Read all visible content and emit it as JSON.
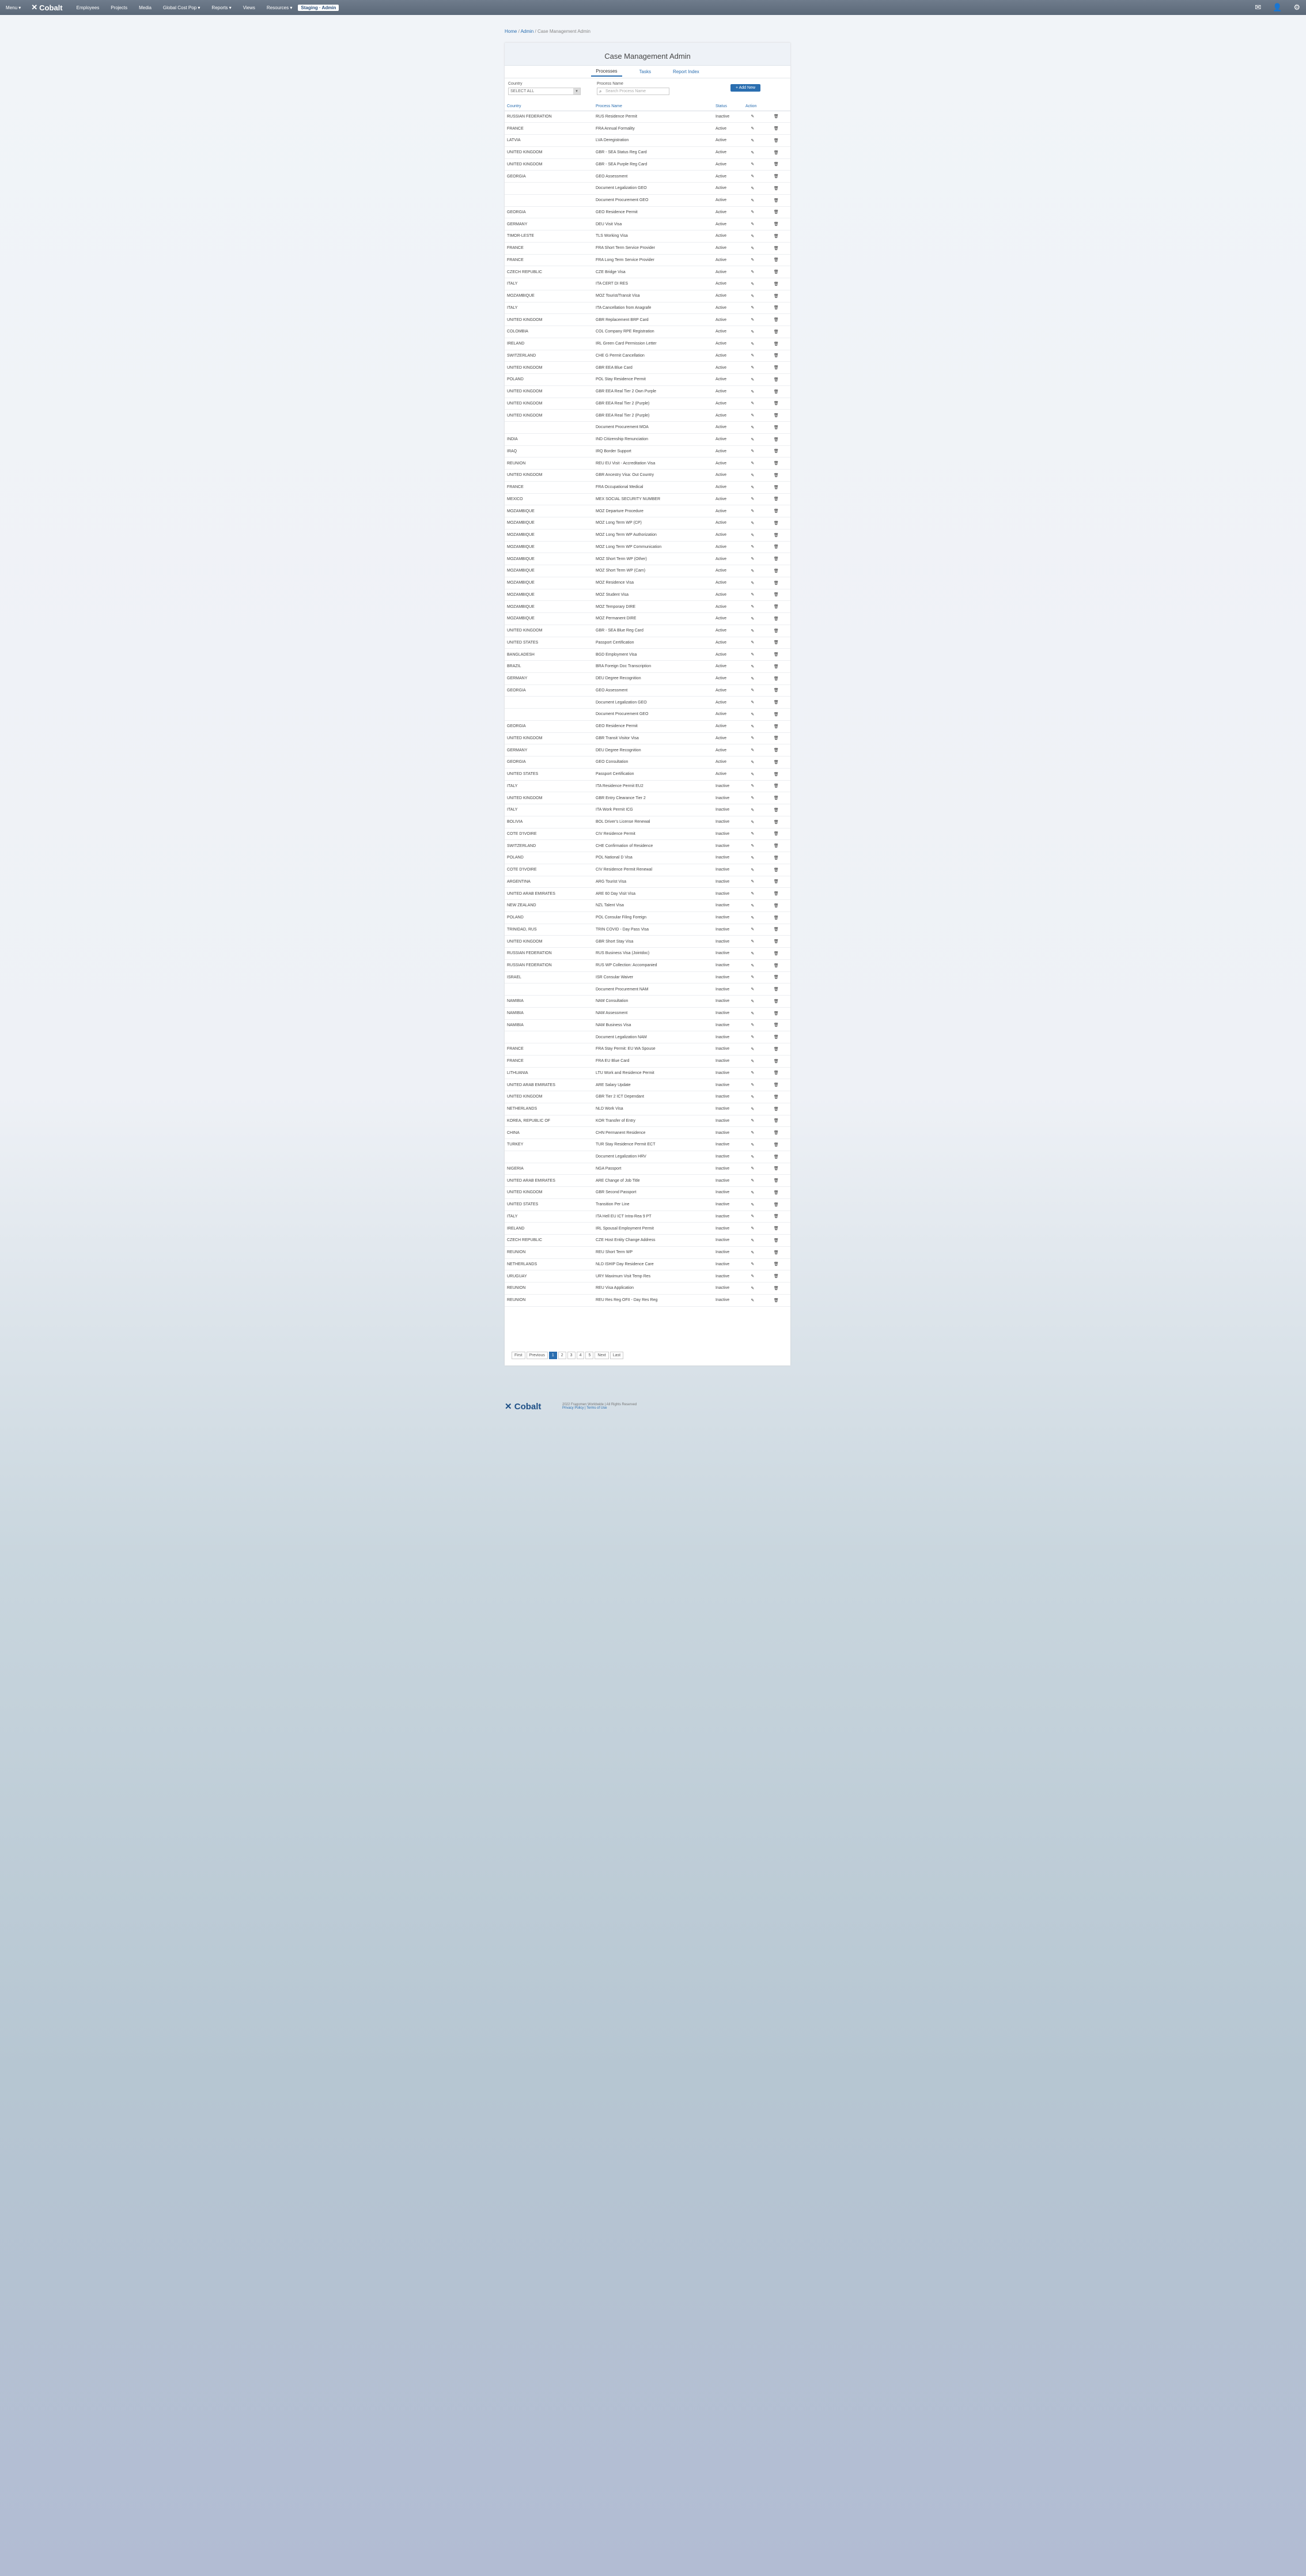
{
  "topbar": {
    "menu": "Menu",
    "logo": "Cobalt",
    "items": [
      "Employees",
      "Projects",
      "Media",
      "Global Cost Pop",
      "Reports",
      "Views",
      "Resources"
    ],
    "highlight": "Staging · Admin"
  },
  "breadcrumb": {
    "home": "Home",
    "admin": "Admin",
    "current": "Case Management Admin"
  },
  "panel": {
    "title": "Case Management Admin"
  },
  "tabs": [
    "Processes",
    "Tasks",
    "Report Index"
  ],
  "filters": {
    "country_label": "Country",
    "country_value": "SELECT ALL",
    "process_label": "Process Name",
    "process_placeholder": "Search Process Name"
  },
  "add_button": "+ Add New",
  "table": {
    "headers": [
      "Country",
      "Process Name",
      "Status",
      "Action"
    ],
    "rows": [
      [
        "RUSSIAN FEDERATION",
        "RUS Residence Permit",
        "Inactive"
      ],
      [
        "FRANCE",
        "FRA Annual Formality",
        "Active"
      ],
      [
        "LATVIA",
        "LVA Deregistration",
        "Active"
      ],
      [
        "UNITED KINGDOM",
        "GBR - SEA Status Reg Card",
        "Active"
      ],
      [
        "UNITED KINGDOM",
        "GBR - SEA Purple Reg Card",
        "Active"
      ],
      [
        "GEORGIA",
        "GEO Assessment",
        "Active"
      ],
      [
        "",
        "Document Legalization GEO",
        "Active"
      ],
      [
        "",
        "Document Procurement GEO",
        "Active"
      ],
      [
        "GEORGIA",
        "GEO Residence Permit",
        "Active"
      ],
      [
        "GERMANY",
        "DEU Visit Visa",
        "Active"
      ],
      [
        "TIMOR-LESTE",
        "TLS Working Visa",
        "Active"
      ],
      [
        "FRANCE",
        "FRA Short Term Service Provider",
        "Active"
      ],
      [
        "FRANCE",
        "FRA Long Term Service Provider",
        "Active"
      ],
      [
        "CZECH REPUBLIC",
        "CZE Bridge Visa",
        "Active"
      ],
      [
        "ITALY",
        "ITA CERT DI RES",
        "Active"
      ],
      [
        "MOZAMBIQUE",
        "MOZ Tourist/Transit Visa",
        "Active"
      ],
      [
        "ITALY",
        "ITA Cancellation from Anagrafe",
        "Active"
      ],
      [
        "UNITED KINGDOM",
        "GBR Replacement BRP Card",
        "Active"
      ],
      [
        "COLOMBIA",
        "COL Company RPE Registration",
        "Active"
      ],
      [
        "IRELAND",
        "IRL Green Card Permission Letter",
        "Active"
      ],
      [
        "SWITZERLAND",
        "CHE G Permit Cancellation",
        "Active"
      ],
      [
        "UNITED KINGDOM",
        "GBR EEA Blue Card",
        "Active"
      ],
      [
        "POLAND",
        "POL Stay Residence Permit",
        "Active"
      ],
      [
        "UNITED KINGDOM",
        "GBR EEA Real Tier 2 Own Purple",
        "Active"
      ],
      [
        "UNITED KINGDOM",
        "GBR EEA Real Tier 2 (Purple)",
        "Active"
      ],
      [
        "UNITED KINGDOM",
        "GBR EEA Real Tier 2 (Purple)",
        "Active"
      ],
      [
        "",
        "Document Procurement MOA",
        "Active"
      ],
      [
        "INDIA",
        "IND Citizenship Renunciation",
        "Active"
      ],
      [
        "IRAQ",
        "IRQ Border Support",
        "Active"
      ],
      [
        "REUNION",
        "REU EU Visit - Accreditation Visa",
        "Active"
      ],
      [
        "UNITED KINGDOM",
        "GBR Ancestry Visa: Out Country",
        "Active"
      ],
      [
        "FRANCE",
        "FRA Occupational Medical",
        "Active"
      ],
      [
        "MEXICO",
        "MEX SOCIAL SECURITY NUMBER",
        "Active"
      ],
      [
        "MOZAMBIQUE",
        "MOZ Departure Procedure",
        "Active"
      ],
      [
        "MOZAMBIQUE",
        "MOZ Long Term WP (CP)",
        "Active"
      ],
      [
        "MOZAMBIQUE",
        "MOZ Long Term WP Authorization",
        "Active"
      ],
      [
        "MOZAMBIQUE",
        "MOZ Long Term WP Communication",
        "Active"
      ],
      [
        "MOZAMBIQUE",
        "MOZ Short Term WP (Other)",
        "Active"
      ],
      [
        "MOZAMBIQUE",
        "MOZ Short Term WP (Cam)",
        "Active"
      ],
      [
        "MOZAMBIQUE",
        "MOZ Residence Visa",
        "Active"
      ],
      [
        "MOZAMBIQUE",
        "MOZ Student Visa",
        "Active"
      ],
      [
        "MOZAMBIQUE",
        "MOZ Temporary DIRE",
        "Active"
      ],
      [
        "MOZAMBIQUE",
        "MOZ Permanent DIRE",
        "Active"
      ],
      [
        "UNITED KINGDOM",
        "GBR - SEA Blue Reg Card",
        "Active"
      ],
      [
        "UNITED STATES",
        "Passport Certification",
        "Active"
      ],
      [
        "BANGLADESH",
        "BGD Employment Visa",
        "Active"
      ],
      [
        "BRAZIL",
        "BRA Foreign Doc Transcription",
        "Active"
      ],
      [
        "GERMANY",
        "DEU Degree Recognition",
        "Active"
      ],
      [
        "GEORGIA",
        "GEO Assessment",
        "Active"
      ],
      [
        "",
        "Document Legalization GEO",
        "Active"
      ],
      [
        "",
        "Document Procurement GEO",
        "Active"
      ],
      [
        "GEORGIA",
        "GEO Residence Permit",
        "Active"
      ],
      [
        "UNITED KINGDOM",
        "GBR Transit Visitor Visa",
        "Active"
      ],
      [
        "GERMANY",
        "DEU Degree Recognition",
        "Active"
      ],
      [
        "GEORGIA",
        "GEO Consultation",
        "Active"
      ],
      [
        "UNITED STATES",
        "Passport Certification",
        "Active"
      ],
      [
        "ITALY",
        "ITA Residence Permit EU2",
        "Inactive"
      ],
      [
        "UNITED KINGDOM",
        "GBR Entry Clearance Tier 2",
        "Inactive"
      ],
      [
        "ITALY",
        "ITA Work Permit ICG",
        "Inactive"
      ],
      [
        "BOLIVIA",
        "BOL Driver's License Renewal",
        "Inactive"
      ],
      [
        "COTE D'IVOIRE",
        "CIV Residence Permit",
        "Inactive"
      ],
      [
        "SWITZERLAND",
        "CHE Confirmation of Residence",
        "Inactive"
      ],
      [
        "POLAND",
        "POL National D Visa",
        "Inactive"
      ],
      [
        "COTE D'IVOIRE",
        "CIV Residence Permit Renewal",
        "Inactive"
      ],
      [
        "ARGENTINA",
        "ARG Tourist Visa",
        "Inactive"
      ],
      [
        "UNITED ARAB EMIRATES",
        "ARE 60 Day Visit Visa",
        "Inactive"
      ],
      [
        "NEW ZEALAND",
        "NZL Talent Visa",
        "Inactive"
      ],
      [
        "POLAND",
        "POL Consular Filing Foreign",
        "Inactive"
      ],
      [
        "TRINIDAD, RUS",
        "TRIN COVID - Day Pass Visa",
        "Inactive"
      ],
      [
        "UNITED KINGDOM",
        "GBR Short Stay Visa",
        "Inactive"
      ],
      [
        "RUSSIAN FEDERATION",
        "RUS Business Visa (Jointdoc)",
        "Inactive"
      ],
      [
        "RUSSIAN FEDERATION",
        "RUS WP Collection: Accompanied",
        "Inactive"
      ],
      [
        "ISRAEL",
        "ISR Consular Waiver",
        "Inactive"
      ],
      [
        "",
        "Document Procurement NAM",
        "Inactive"
      ],
      [
        "NAMIBIA",
        "NAM Consultation",
        "Inactive"
      ],
      [
        "NAMIBIA",
        "NAM Assessment",
        "Inactive"
      ],
      [
        "NAMIBIA",
        "NAM Business Visa",
        "Inactive"
      ],
      [
        "",
        "Document Legalization NAM",
        "Inactive"
      ],
      [
        "FRANCE",
        "FRA Stay Permit: EU WA Spouse",
        "Inactive"
      ],
      [
        "FRANCE",
        "FRA EU Blue Card",
        "Inactive"
      ],
      [
        "LITHUANIA",
        "LTU Work and Residence Permit",
        "Inactive"
      ],
      [
        "UNITED ARAB EMIRATES",
        "ARE Salary Update",
        "Inactive"
      ],
      [
        "UNITED KINGDOM",
        "GBR Tier 2 ICT Dependant",
        "Inactive"
      ],
      [
        "NETHERLANDS",
        "NLD Work Visa",
        "Inactive"
      ],
      [
        "KOREA, REPUBLIC OF",
        "KOR Transfer of Entry",
        "Inactive"
      ],
      [
        "CHINA",
        "CHN Permanent Residence",
        "Inactive"
      ],
      [
        "TURKEY",
        "TUR Stay Residence Permit ECT",
        "Inactive"
      ],
      [
        "",
        "Document Legalization HRV",
        "Inactive"
      ],
      [
        "NIGERIA",
        "NGA Passport",
        "Inactive"
      ],
      [
        "UNITED ARAB EMIRATES",
        "ARE Change of Job Title",
        "Inactive"
      ],
      [
        "UNITED KINGDOM",
        "GBR Second Passport",
        "Inactive"
      ],
      [
        "UNITED STATES",
        "Transition Per Line",
        "Inactive"
      ],
      [
        "ITALY",
        "ITA Hell EU ICT Intra-Rea 9 PT",
        "Inactive"
      ],
      [
        "IRELAND",
        "IRL Spousal Employment Permit",
        "Inactive"
      ],
      [
        "CZECH REPUBLIC",
        "CZE Host Entity Change Address",
        "Inactive"
      ],
      [
        "REUNION",
        "REU Short Term WP",
        "Inactive"
      ],
      [
        "NETHERLANDS",
        "NLD ISHIP Day Residence Care",
        "Inactive"
      ],
      [
        "URUGUAY",
        "URY Maximum Visit Temp Res",
        "Inactive"
      ],
      [
        "REUNION",
        "REU Visa Application",
        "Inactive"
      ],
      [
        "REUNION",
        "REU Res Reg OFII - Day Res Reg",
        "Inactive"
      ]
    ]
  },
  "pagination": [
    "First",
    "Previous",
    "1",
    "2",
    "3",
    "4",
    "5",
    "Next",
    "Last"
  ],
  "footer": {
    "logo": "Cobalt",
    "line1": "2022 Fragomen Worldwide | All Rights Reserved",
    "line2": "Privacy Policy | Terms of Use"
  }
}
